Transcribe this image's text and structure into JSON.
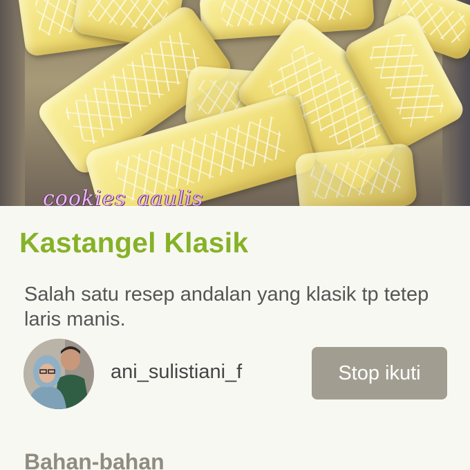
{
  "hero": {
    "watermark": "cookies_aaulis"
  },
  "recipe": {
    "title": "Kastangel Klasik",
    "description": "Salah satu resep andalan yang klasik tp tetep laris manis."
  },
  "author": {
    "username": "ani_sulistiani_f",
    "follow_button_label": "Stop ikuti"
  },
  "sections": {
    "ingredients_heading": "Bahan-bahan"
  },
  "colors": {
    "title_green": "#86b227",
    "button_gray": "#a19e91",
    "background": "#f8f8f3"
  }
}
